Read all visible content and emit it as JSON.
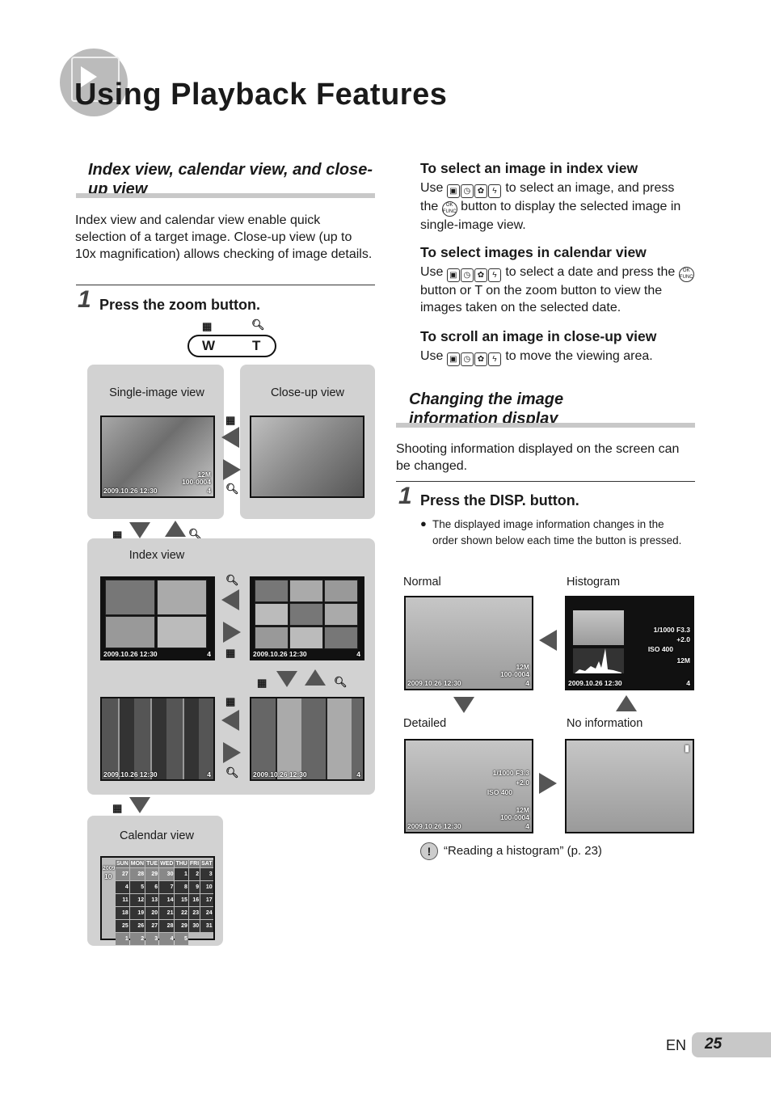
{
  "title": "Using Playback Features",
  "title_icon": "playback-icon",
  "left": {
    "section_title": "Index view, calendar view, and close-up view",
    "intro": "Index view and calendar view enable quick selection of a target image. Close-up view (up to 10x magnification) allows checking of image details.",
    "step_num": "1",
    "step_label": "Press the zoom button.",
    "zoom": {
      "w": "W",
      "t": "T"
    },
    "single_label": "Single-image view",
    "closeup_label": "Close-up view",
    "index_label": "Index view",
    "calendar_label": "Calendar view",
    "osd": {
      "date": "2009.10.26  12:30",
      "file": "100-0004",
      "count": "4",
      "size": "12M",
      "norm": "NORM",
      "mem": "IN"
    },
    "calendar": {
      "year": "2009",
      "month": "10",
      "days": [
        "SUN",
        "MON",
        "TUE",
        "WED",
        "THU",
        "FRI",
        "SAT"
      ],
      "weeks": [
        [
          "27",
          "28",
          "29",
          "30",
          "1",
          "2",
          "3"
        ],
        [
          "4",
          "5",
          "6",
          "7",
          "8",
          "9",
          "10"
        ],
        [
          "11",
          "12",
          "13",
          "14",
          "15",
          "16",
          "17"
        ],
        [
          "18",
          "19",
          "20",
          "21",
          "22",
          "23",
          "24"
        ],
        [
          "25",
          "26",
          "27",
          "28",
          "29",
          "30",
          "31"
        ],
        [
          "1",
          "2",
          "3",
          "4",
          "5",
          "",
          ""
        ]
      ]
    }
  },
  "right": {
    "sub1_title": "To select an image in index view",
    "sub1_pre": "Use",
    "sub1_a": "to select an image, and",
    "sub1_b": "press the",
    "sub1_c": "button to display the selected image in single-image view.",
    "sub2_title": "To select images in calendar view",
    "sub2_pre": "Use",
    "sub2_a": "to select a date and press",
    "sub2_b": "the",
    "sub2_c": "button or T on the zoom button to view the images taken on the selected date.",
    "sub3_title": "To scroll an image in close-up view",
    "sub3_pre": "Use",
    "sub3_a": "to move the viewing area.",
    "section_title": "Changing the image information display",
    "intro": "Shooting information displayed on the screen can be changed.",
    "step_num": "1",
    "step_label": "Press the DISP. button.",
    "bullet": "The displayed image information changes in the order shown below each time the button is pressed.",
    "normal_label": "Normal",
    "histogram_label": "Histogram",
    "detailed_label": "Detailed",
    "noinfo_label": "No information",
    "osd": {
      "date": "2009.10.26  12:30",
      "date_alt": "2009.10.26  12:30",
      "shutter": "1/1000  F3.3",
      "ev": "+2.0",
      "iso": "ISO 400",
      "file": "100-0004",
      "count": "4",
      "size": "12M",
      "norm": "NORM",
      "mem": "IN"
    },
    "ref": "“Reading a histogram” (p. 23)",
    "ok_label": "OK FUNC"
  },
  "footer": {
    "lang": "EN",
    "page": "25"
  },
  "colors": {
    "panel": "#d2d2d2",
    "bar": "#c8c8c8",
    "text": "#1a1a1a"
  }
}
